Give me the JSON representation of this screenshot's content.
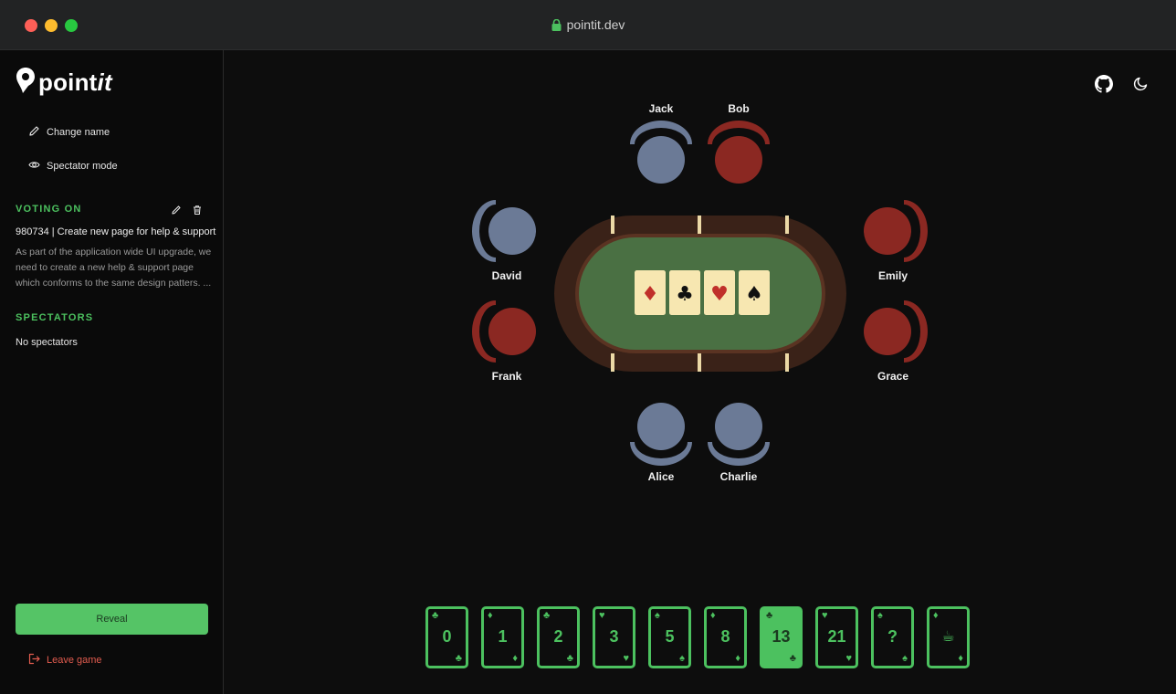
{
  "browser": {
    "url": "pointit.dev"
  },
  "logo": {
    "text_main": "point",
    "text_italic": "it"
  },
  "sidebar": {
    "change_name": "Change name",
    "spectator_mode": "Spectator mode",
    "voting_on_title": "VOTING ON",
    "issue_title": "980734 | Create new page for help & support",
    "issue_description": "As part of the application wide UI upgrade, we need to create a new help & support page which conforms to the same design patters. ...",
    "spectators_title": "SPECTATORS",
    "no_spectators": "No spectators",
    "reveal_label": "Reveal",
    "leave_label": "Leave game"
  },
  "players": {
    "jack": "Jack",
    "bob": "Bob",
    "david": "David",
    "emily": "Emily",
    "frank": "Frank",
    "grace": "Grace",
    "alice": "Alice",
    "charlie": "Charlie"
  },
  "colors": {
    "accent": "#4cc15f",
    "voted": "#8b2822",
    "waiting": "#6b7a96",
    "table_felt": "#4a7043",
    "table_rim": "#3a2218",
    "danger": "#e25c4f"
  },
  "deck": [
    {
      "value": "0",
      "suit": "♣",
      "selected": false
    },
    {
      "value": "1",
      "suit": "♦",
      "selected": false
    },
    {
      "value": "2",
      "suit": "♣",
      "selected": false
    },
    {
      "value": "3",
      "suit": "♥",
      "selected": false
    },
    {
      "value": "5",
      "suit": "♠",
      "selected": false
    },
    {
      "value": "8",
      "suit": "♦",
      "selected": false
    },
    {
      "value": "13",
      "suit": "♣",
      "selected": true
    },
    {
      "value": "21",
      "suit": "♥",
      "selected": false
    },
    {
      "value": "?",
      "suit": "♠",
      "selected": false
    },
    {
      "value": "☕",
      "suit": "♦",
      "selected": false
    }
  ],
  "table_cards": [
    "♦",
    "♣",
    "♥",
    "♠"
  ]
}
